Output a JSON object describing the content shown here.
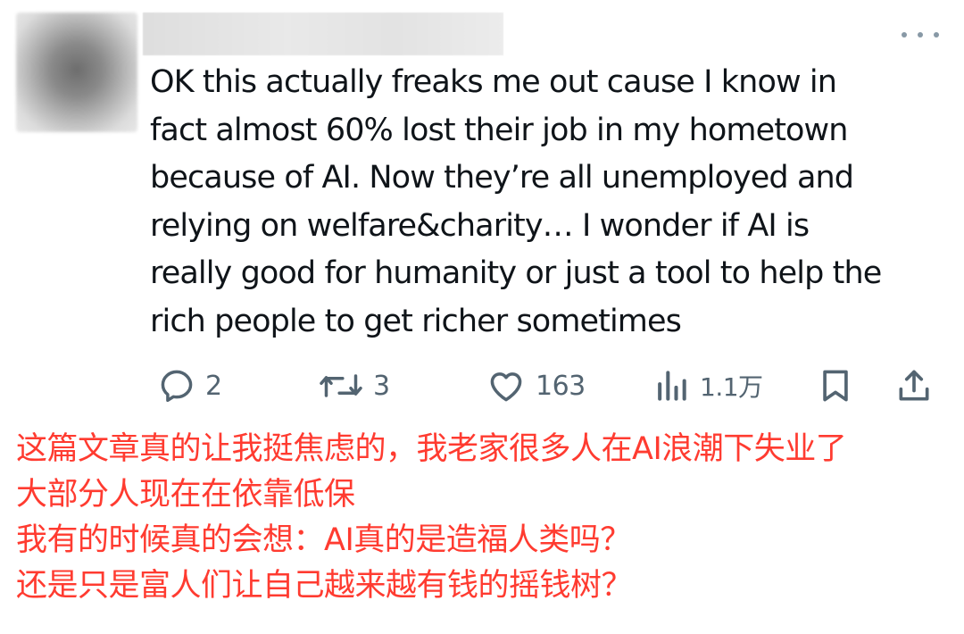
{
  "tweet": {
    "author_avatar": "blurred-avatar",
    "author_name": "",
    "text": "OK this actually freaks me out cause I know in\nfact almost 60% lost their job in my hometown\nbecause of AI. Now they’re all unemployed and\nrelying on welfare&charity… I wonder if AI is\nreally good for humanity or just a tool to help the\nrich people to get richer sometimes",
    "metrics": {
      "replies": "2",
      "retweets": "3",
      "likes": "163",
      "views": "1.1万"
    },
    "icons": {
      "more": "more-horizontal-icon",
      "reply": "reply-icon",
      "retweet": "retweet-icon",
      "like": "heart-icon",
      "views": "views-icon",
      "bookmark": "bookmark-icon",
      "share": "share-icon"
    },
    "colors": {
      "text": "#0f1419",
      "icon": "#536471"
    }
  },
  "caption": {
    "color": "#ff3b30",
    "lines": [
      "这篇文章真的让我挺焦虑的，我老家很多人在AI浪潮下失业了",
      "大部分人现在在依靠低保",
      "我有的时候真的会想：AI真的是造福人类吗？",
      "还是只是富人们让自己越来越有钱的摇钱树？"
    ]
  }
}
